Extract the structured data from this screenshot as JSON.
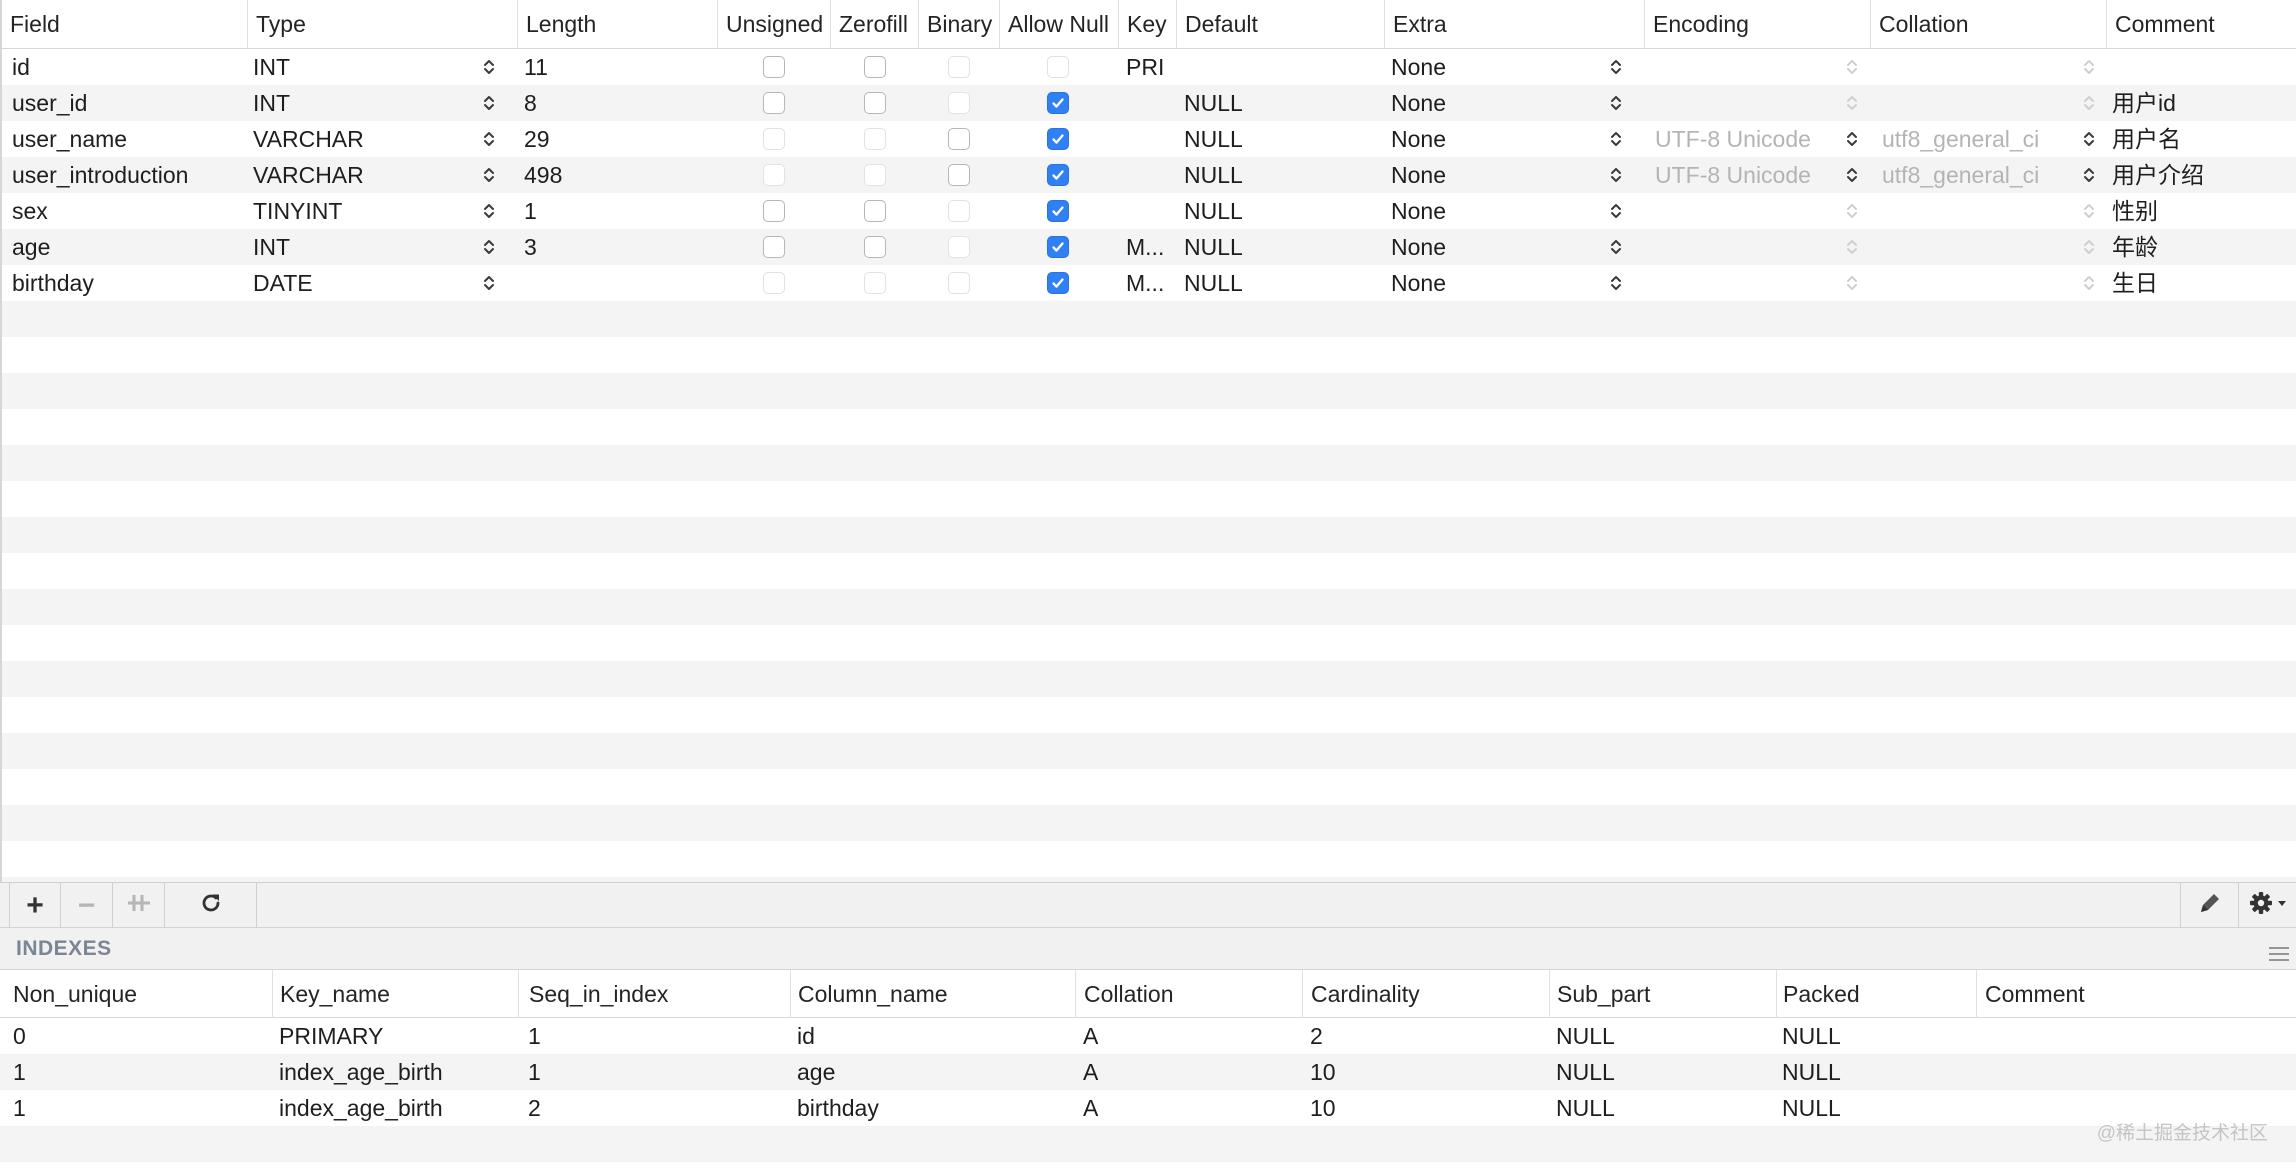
{
  "structure": {
    "columns": [
      "Field",
      "Type",
      "Length",
      "Unsigned",
      "Zerofill",
      "Binary",
      "Allow Null",
      "Key",
      "Default",
      "Extra",
      "Encoding",
      "Collation",
      "Comment"
    ],
    "rows": [
      {
        "field": "id",
        "type": "INT",
        "length": "11",
        "unsigned": "unchecked",
        "zerofill": "unchecked",
        "binary": "disabled",
        "allow_null": "disabled",
        "key": "PRI",
        "default": "",
        "extra": "None",
        "encoding": "",
        "encoding_enabled": false,
        "collation": "",
        "collation_enabled": false,
        "comment": ""
      },
      {
        "field": "user_id",
        "type": "INT",
        "length": "8",
        "unsigned": "unchecked",
        "zerofill": "unchecked",
        "binary": "disabled",
        "allow_null": "checked",
        "key": "",
        "default": "NULL",
        "extra": "None",
        "encoding": "",
        "encoding_enabled": false,
        "collation": "",
        "collation_enabled": false,
        "comment": "用户id"
      },
      {
        "field": "user_name",
        "type": "VARCHAR",
        "length": "29",
        "unsigned": "disabled",
        "zerofill": "disabled",
        "binary": "unchecked",
        "allow_null": "checked",
        "key": "",
        "default": "NULL",
        "extra": "None",
        "encoding": "UTF-8 Unicode",
        "encoding_enabled": true,
        "collation": "utf8_general_ci",
        "collation_enabled": true,
        "comment": "用户名"
      },
      {
        "field": "user_introduction",
        "type": "VARCHAR",
        "length": "498",
        "unsigned": "disabled",
        "zerofill": "disabled",
        "binary": "unchecked",
        "allow_null": "checked",
        "key": "",
        "default": "NULL",
        "extra": "None",
        "encoding": "UTF-8 Unicode",
        "encoding_enabled": true,
        "collation": "utf8_general_ci",
        "collation_enabled": true,
        "comment": "用户介绍"
      },
      {
        "field": "sex",
        "type": "TINYINT",
        "length": "1",
        "unsigned": "unchecked",
        "zerofill": "unchecked",
        "binary": "disabled",
        "allow_null": "checked",
        "key": "",
        "default": "NULL",
        "extra": "None",
        "encoding": "",
        "encoding_enabled": false,
        "collation": "",
        "collation_enabled": false,
        "comment": "性别"
      },
      {
        "field": "age",
        "type": "INT",
        "length": "3",
        "unsigned": "unchecked",
        "zerofill": "unchecked",
        "binary": "disabled",
        "allow_null": "checked",
        "key": "M...",
        "default": "NULL",
        "extra": "None",
        "encoding": "",
        "encoding_enabled": false,
        "collation": "",
        "collation_enabled": false,
        "comment": "年龄"
      },
      {
        "field": "birthday",
        "type": "DATE",
        "length": "",
        "unsigned": "disabled",
        "zerofill": "disabled",
        "binary": "disabled",
        "allow_null": "checked",
        "key": "M...",
        "default": "NULL",
        "extra": "None",
        "encoding": "",
        "encoding_enabled": false,
        "collation": "",
        "collation_enabled": false,
        "comment": "生日"
      }
    ]
  },
  "toolbar": {
    "add": "+",
    "remove": "−",
    "duplicate": "add-duplicate-icon",
    "refresh": "refresh-icon",
    "edit": "pencil-icon",
    "settings": "gear-icon"
  },
  "indexes": {
    "title": "INDEXES",
    "columns": [
      "Non_unique",
      "Key_name",
      "Seq_in_index",
      "Column_name",
      "Collation",
      "Cardinality",
      "Sub_part",
      "Packed",
      "Comment"
    ],
    "rows": [
      [
        "0",
        "PRIMARY",
        "1",
        "id",
        "A",
        "2",
        "NULL",
        "NULL",
        ""
      ],
      [
        "1",
        "index_age_birth",
        "1",
        "age",
        "A",
        "10",
        "NULL",
        "NULL",
        ""
      ],
      [
        "1",
        "index_age_birth",
        "2",
        "birthday",
        "A",
        "10",
        "NULL",
        "NULL",
        ""
      ]
    ]
  },
  "watermark": "@稀土掘金技术社区",
  "colors": {
    "accent": "#2f7ff5",
    "header_text": "#242424",
    "indexes_title": "#7c8594",
    "stripe": "#f4f4f4"
  }
}
